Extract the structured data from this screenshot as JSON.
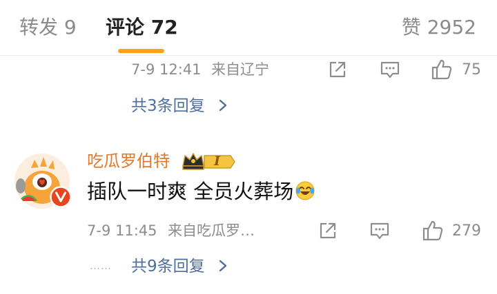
{
  "tabs": {
    "reposts": "转发 9",
    "comments": "评论 72",
    "likes": "赞 2952"
  },
  "comment1": {
    "time": "7-9 12:41",
    "location": "来自辽宁",
    "like_count": "75",
    "replies": "共3条回复"
  },
  "comment2": {
    "username": "吃瓜罗伯特",
    "vip_level": "I",
    "text": "插队一时爽 全员火葬场",
    "time": "7-9 11:45",
    "location": "来自吃瓜罗…",
    "like_count": "279",
    "replies": "共9条回复",
    "dots": "……"
  },
  "icons": {
    "share": "share-icon",
    "comment": "comment-icon",
    "like": "thumbs-up-icon",
    "chevron": "chevron-right-icon",
    "verified": "verified-v-icon",
    "crown": "crown-icon"
  },
  "colors": {
    "accent": "#f7a217",
    "link": "#4f6e9b",
    "username": "#e07a2e",
    "verified": "#e8451e"
  }
}
